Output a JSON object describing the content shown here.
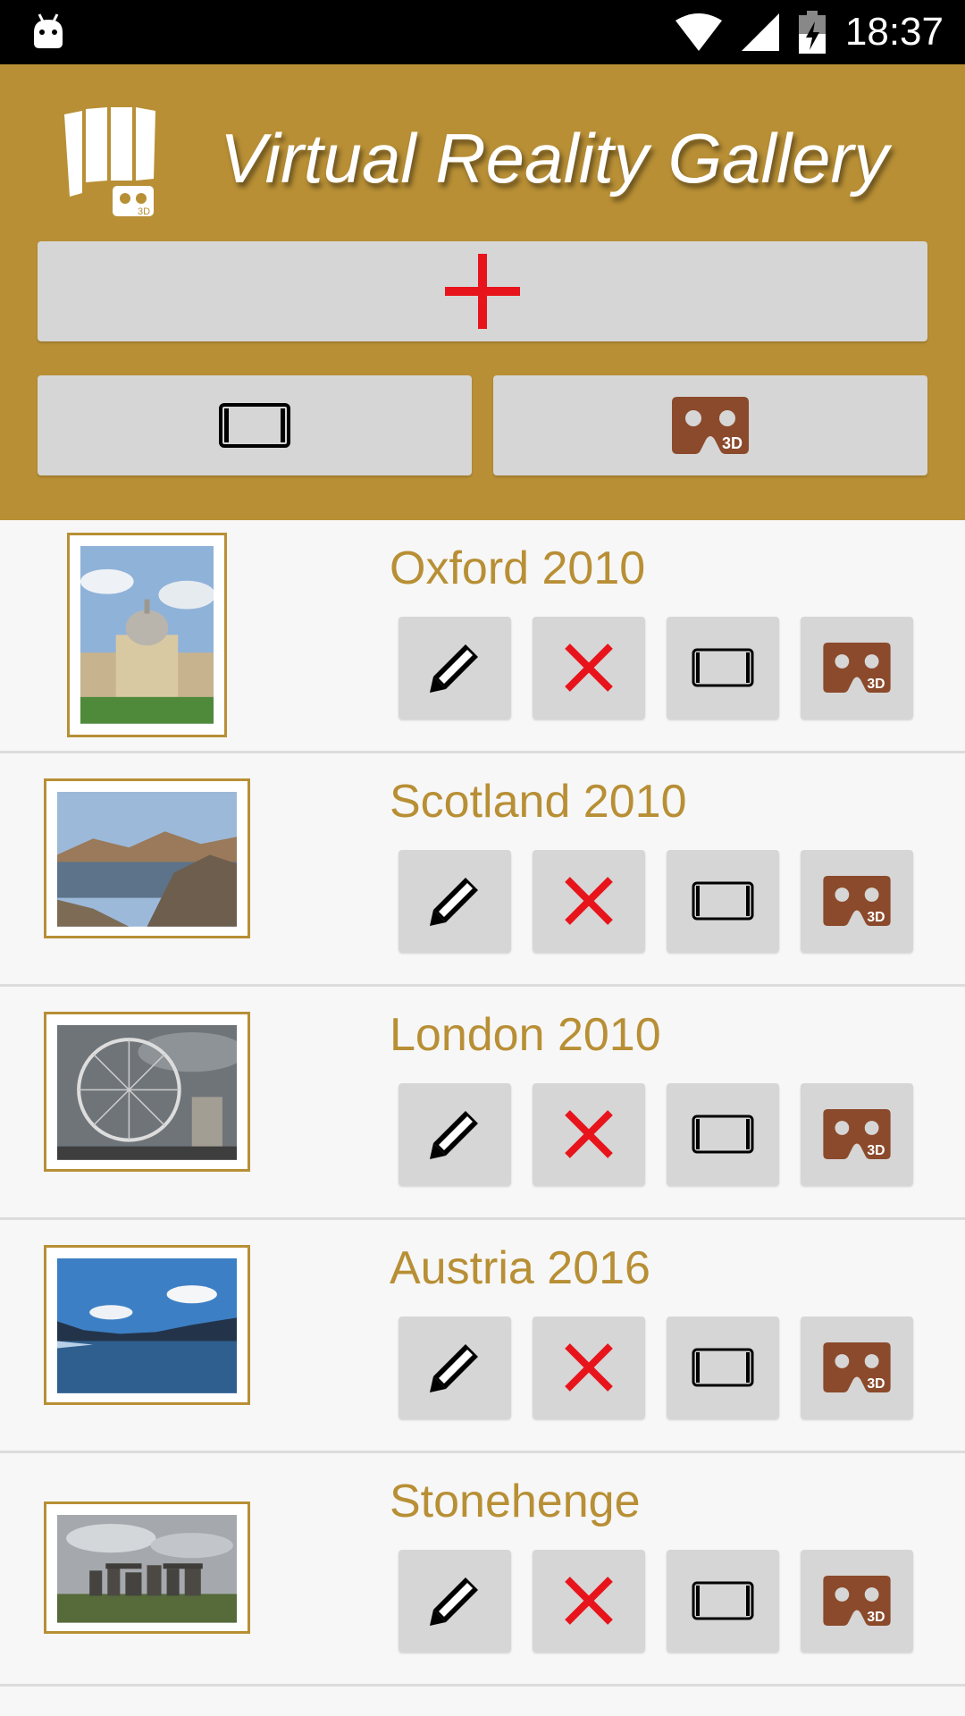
{
  "status_bar": {
    "time": "18:37"
  },
  "header": {
    "title": "Virtual Reality Gallery"
  },
  "colors": {
    "accent": "#b88f35",
    "button": "#d6d6d6",
    "add": "#e8141c",
    "vr": "#8b4a2b"
  },
  "albums": [
    {
      "title": "Oxford 2010"
    },
    {
      "title": "Scotland 2010"
    },
    {
      "title": "London 2010"
    },
    {
      "title": "Austria 2016"
    },
    {
      "title": "Stonehenge"
    }
  ]
}
